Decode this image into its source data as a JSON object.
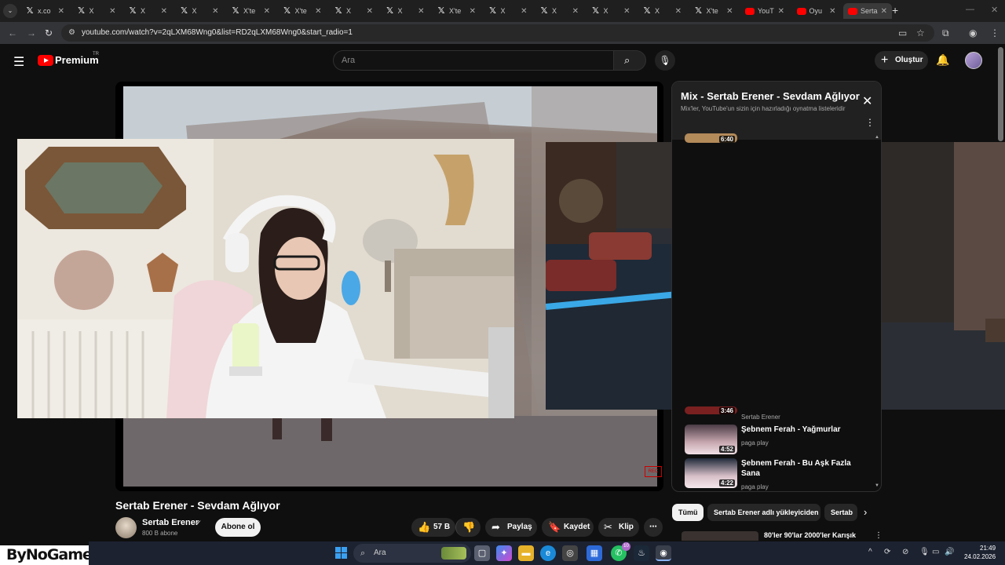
{
  "browser": {
    "tabs": [
      {
        "favicon": "x-icon",
        "title": "x.co"
      },
      {
        "favicon": "x-icon",
        "title": "X"
      },
      {
        "favicon": "x-icon",
        "title": "X"
      },
      {
        "favicon": "x-icon",
        "title": "X"
      },
      {
        "favicon": "x-icon",
        "title": "X'te"
      },
      {
        "favicon": "x-icon",
        "title": "X'te"
      },
      {
        "favicon": "x-icon",
        "title": "X"
      },
      {
        "favicon": "x-icon",
        "title": "X"
      },
      {
        "favicon": "x-icon",
        "title": "X'te"
      },
      {
        "favicon": "x-icon",
        "title": "X"
      },
      {
        "favicon": "x-icon",
        "title": "X"
      },
      {
        "favicon": "x-icon",
        "title": "X"
      },
      {
        "favicon": "x-icon",
        "title": "X"
      },
      {
        "favicon": "x-icon",
        "title": "X'te"
      },
      {
        "favicon": "youtube-icon",
        "title": "YouT"
      },
      {
        "favicon": "youtube-icon",
        "title": "Oyu"
      },
      {
        "favicon": "youtube-icon",
        "title": "Serta"
      }
    ],
    "url": "youtube.com/watch?v=2qLXM68Wng0&list=RD2qLXM68Wng0&start_radio=1"
  },
  "masthead": {
    "brand": "Premium",
    "country": "TR",
    "search_placeholder": "Ara",
    "create_label": "Oluştur"
  },
  "video": {
    "title": "Sertab Erener - Sevdam Ağlıyor",
    "channel": "Sertab Erener",
    "subscribers": "800 B abone",
    "subscribe_label": "Abone ol",
    "likes": "57 B",
    "share_label": "Paylaş",
    "save_label": "Kaydet",
    "clip_label": "Klip"
  },
  "mix": {
    "title": "Mix - Sertab Erener - Sevdam Ağlıyor",
    "subtitle": "Mix'ler, YouTube'un sizin için hazırladığı oynatma listeleridir",
    "items": [
      {
        "duration": "6:40",
        "title": "",
        "channel": ""
      },
      {
        "duration": "3:46",
        "title": "",
        "channel": "Sertab Erener"
      },
      {
        "duration": "4:52",
        "title": "Şebnem Ferah - Yağmurlar",
        "channel": "paga play"
      },
      {
        "duration": "4:22",
        "title": "Şebnem Ferah - Bu Aşk Fazla Sana",
        "channel": "paga play"
      }
    ]
  },
  "chips": [
    "Tümü",
    "Sertab Erener adlı yükleyiciden",
    "Sertab"
  ],
  "recommendation": {
    "title": "80'ler 90'lar 2000'ler Karışık"
  },
  "watermark": {
    "text": "ByNoGame"
  },
  "taskbar": {
    "search_placeholder": "Ara",
    "time": "21:49",
    "date": "24.02.2026",
    "whatsapp_badge": "10"
  }
}
